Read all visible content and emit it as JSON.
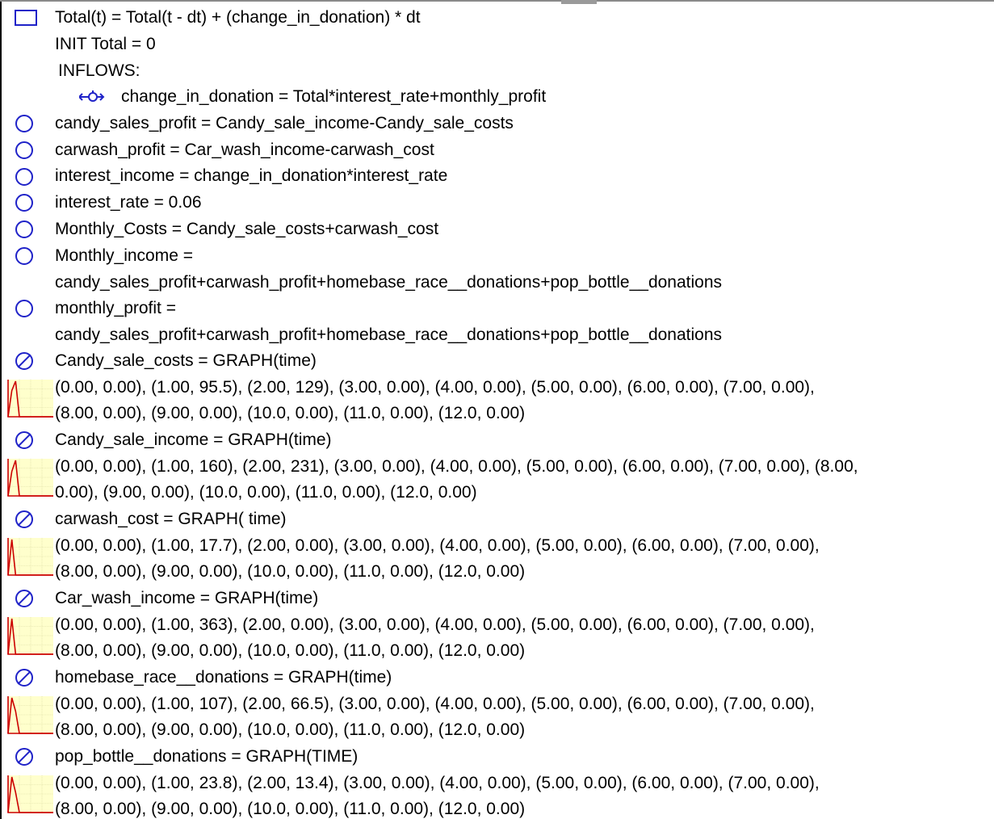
{
  "stock": {
    "equation": "Total(t) = Total(t - dt) + (change_in_donation) * dt",
    "init": "INIT Total = 0",
    "inflows_label": "INFLOWS:",
    "inflow": "change_in_donation = Total*interest_rate+monthly_profit"
  },
  "converters": [
    {
      "line1": "candy_sales_profit = Candy_sale_income-Candy_sale_costs"
    },
    {
      "line1": "carwash_profit = Car_wash_income-carwash_cost"
    },
    {
      "line1": "interest_income = change_in_donation*interest_rate"
    },
    {
      "line1": "interest_rate = 0.06"
    },
    {
      "line1": "Monthly_Costs = Candy_sale_costs+carwash_cost"
    },
    {
      "line1": "Monthly_income =",
      "line2": "candy_sales_profit+carwash_profit+homebase_race__donations+pop_bottle__donations"
    },
    {
      "line1": "monthly_profit =",
      "line2": "candy_sales_profit+carwash_profit+homebase_race__donations+pop_bottle__donations"
    }
  ],
  "graphs": [
    {
      "name": "Candy_sale_costs = GRAPH(time)",
      "line1": "(0.00, 0.00), (1.00, 95.5), (2.00, 129), (3.00, 0.00), (4.00, 0.00), (5.00, 0.00), (6.00, 0.00), (7.00, 0.00),",
      "line2": "(8.00, 0.00), (9.00, 0.00), (10.0, 0.00), (11.0, 0.00), (12.0, 0.00)",
      "points": [
        0,
        95.5,
        129,
        0,
        0,
        0,
        0,
        0,
        0,
        0,
        0,
        0,
        0
      ]
    },
    {
      "name": "Candy_sale_income = GRAPH(time)",
      "line1": "(0.00, 0.00), (1.00, 160), (2.00, 231), (3.00, 0.00), (4.00, 0.00), (5.00, 0.00), (6.00, 0.00), (7.00, 0.00), (8.00,",
      "line2": "0.00), (9.00, 0.00), (10.0, 0.00), (11.0, 0.00), (12.0, 0.00)",
      "points": [
        0,
        160,
        231,
        0,
        0,
        0,
        0,
        0,
        0,
        0,
        0,
        0,
        0
      ]
    },
    {
      "name": "carwash_cost = GRAPH( time)",
      "line1": "(0.00, 0.00), (1.00, 17.7), (2.00, 0.00), (3.00, 0.00), (4.00, 0.00), (5.00, 0.00), (6.00, 0.00), (7.00, 0.00),",
      "line2": "(8.00, 0.00), (9.00, 0.00), (10.0, 0.00), (11.0, 0.00), (12.0, 0.00)",
      "points": [
        0,
        17.7,
        0,
        0,
        0,
        0,
        0,
        0,
        0,
        0,
        0,
        0,
        0
      ]
    },
    {
      "name": "Car_wash_income = GRAPH(time)",
      "line1": "(0.00, 0.00), (1.00, 363), (2.00, 0.00), (3.00, 0.00), (4.00, 0.00), (5.00, 0.00), (6.00, 0.00), (7.00, 0.00),",
      "line2": "(8.00, 0.00), (9.00, 0.00), (10.0, 0.00), (11.0, 0.00), (12.0, 0.00)",
      "points": [
        0,
        363,
        0,
        0,
        0,
        0,
        0,
        0,
        0,
        0,
        0,
        0,
        0
      ]
    },
    {
      "name": "homebase_race__donations = GRAPH(time)",
      "line1": "(0.00, 0.00), (1.00, 107), (2.00, 66.5), (3.00, 0.00), (4.00, 0.00), (5.00, 0.00), (6.00, 0.00), (7.00, 0.00),",
      "line2": "(8.00, 0.00), (9.00, 0.00), (10.0, 0.00), (11.0, 0.00), (12.0, 0.00)",
      "points": [
        0,
        107,
        66.5,
        0,
        0,
        0,
        0,
        0,
        0,
        0,
        0,
        0,
        0
      ]
    },
    {
      "name": "pop_bottle__donations = GRAPH(TIME)",
      "line1": "(0.00, 0.00), (1.00, 23.8), (2.00, 13.4), (3.00, 0.00), (4.00, 0.00), (5.00, 0.00), (6.00, 0.00), (7.00, 0.00),",
      "line2": "(8.00, 0.00), (9.00, 0.00), (10.0, 0.00), (11.0, 0.00), (12.0, 0.00)",
      "points": [
        0,
        23.8,
        13.4,
        0,
        0,
        0,
        0,
        0,
        0,
        0,
        0,
        0,
        0
      ]
    }
  ],
  "colors": {
    "icon_blue": "#1f22c8",
    "graph_line": "#cc0000",
    "graph_bg": "#ffffcc",
    "graph_grid": "#d8d8a0"
  }
}
